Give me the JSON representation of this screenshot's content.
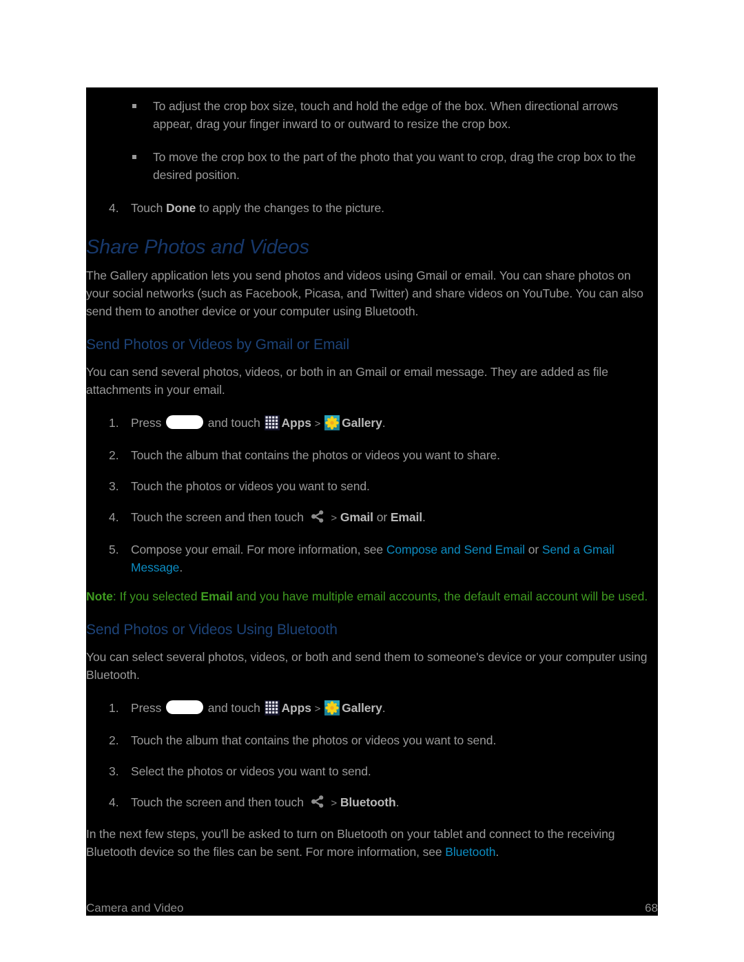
{
  "page": {
    "footer_left": "Camera and Video",
    "footer_page_number": "68",
    "colors": {
      "background": "#000000",
      "body_text": "#9a9a9a",
      "heading": "#17386b",
      "subheading": "#1d4378",
      "link": "#0c8cc2",
      "note": "#3f9c20",
      "outer": "#ffffff"
    }
  },
  "crop_bullets": [
    {
      "text_a": "To adjust the crop box size, touch and hold the edge of the box. When directional arrows appear, drag your finger inward to or outward to resize the crop box."
    },
    {
      "text_a": "To move the crop box to the part of the photo that you want to crop, drag the crop box to the desired position."
    }
  ],
  "crop_step": {
    "number": "4.",
    "pre": "Touch ",
    "bold": "Done",
    "post": " to apply the changes to the picture."
  },
  "share_section": {
    "title": "Share Photos and Videos",
    "intro": "The Gallery application lets you send photos and videos using Gmail or email. You can share photos on your social networks (such as Facebook, Picasa, and Twitter) and share videos on YouTube. You can also send them to another device or your computer using Bluetooth."
  },
  "gmail_section": {
    "title": "Send Photos or Videos by Gmail or Email",
    "intro": "You can send several photos, videos, or both in an Gmail or email message. They are added as file attachments in your email.",
    "steps": {
      "s1": {
        "number": "1.",
        "press": "Press",
        "and_touch": "and touch",
        "apps_label": "Apps",
        "separator": ">",
        "gallery_label": "Gallery",
        "period": "."
      },
      "s2": {
        "number": "2.",
        "text": "Touch the album that contains the photos or videos you want to share."
      },
      "s3": {
        "number": "3.",
        "text": "Touch the photos or videos you want to send."
      },
      "s4": {
        "number": "4.",
        "pre": "Touch the screen and then touch",
        "separator": ">",
        "bold_a": "Gmail",
        "mid": " or ",
        "bold_b": "Email",
        "period": "."
      },
      "s5": {
        "number": "5.",
        "pre": "Compose your email. For more information, see ",
        "link_a": "Compose and Send Email",
        "mid": " or ",
        "link_b": "Send a Gmail Message",
        "period": "."
      }
    },
    "note": {
      "label": "Note",
      "pre": ": If you selected ",
      "bold": "Email",
      "post": " and you have multiple email accounts, the default email account will be used."
    }
  },
  "bluetooth_section": {
    "title": "Send Photos or Videos Using Bluetooth",
    "intro": "You can select several photos, videos, or both and send them to someone's device or your computer using Bluetooth.",
    "steps": {
      "s1": {
        "number": "1.",
        "press": "Press",
        "and_touch": "and touch",
        "apps_label": "Apps",
        "separator": ">",
        "gallery_label": "Gallery",
        "period": "."
      },
      "s2": {
        "number": "2.",
        "text": "Touch the album that contains the photos or videos you want to send."
      },
      "s3": {
        "number": "3.",
        "text": "Select the photos or videos you want to send."
      },
      "s4": {
        "number": "4.",
        "pre": "Touch the screen and then touch",
        "separator": ">",
        "bold_a": "Bluetooth",
        "period": "."
      }
    },
    "outro": {
      "pre": "In the next few steps, you'll be asked to turn on Bluetooth on your tablet and connect to the receiving Bluetooth device so the files can be sent. For more information, see ",
      "link": "Bluetooth",
      "post": "."
    }
  },
  "icons": {
    "home_key": "home-key-icon",
    "apps": "apps-grid-icon",
    "gallery": "gallery-flower-icon",
    "share": "share-icon"
  }
}
